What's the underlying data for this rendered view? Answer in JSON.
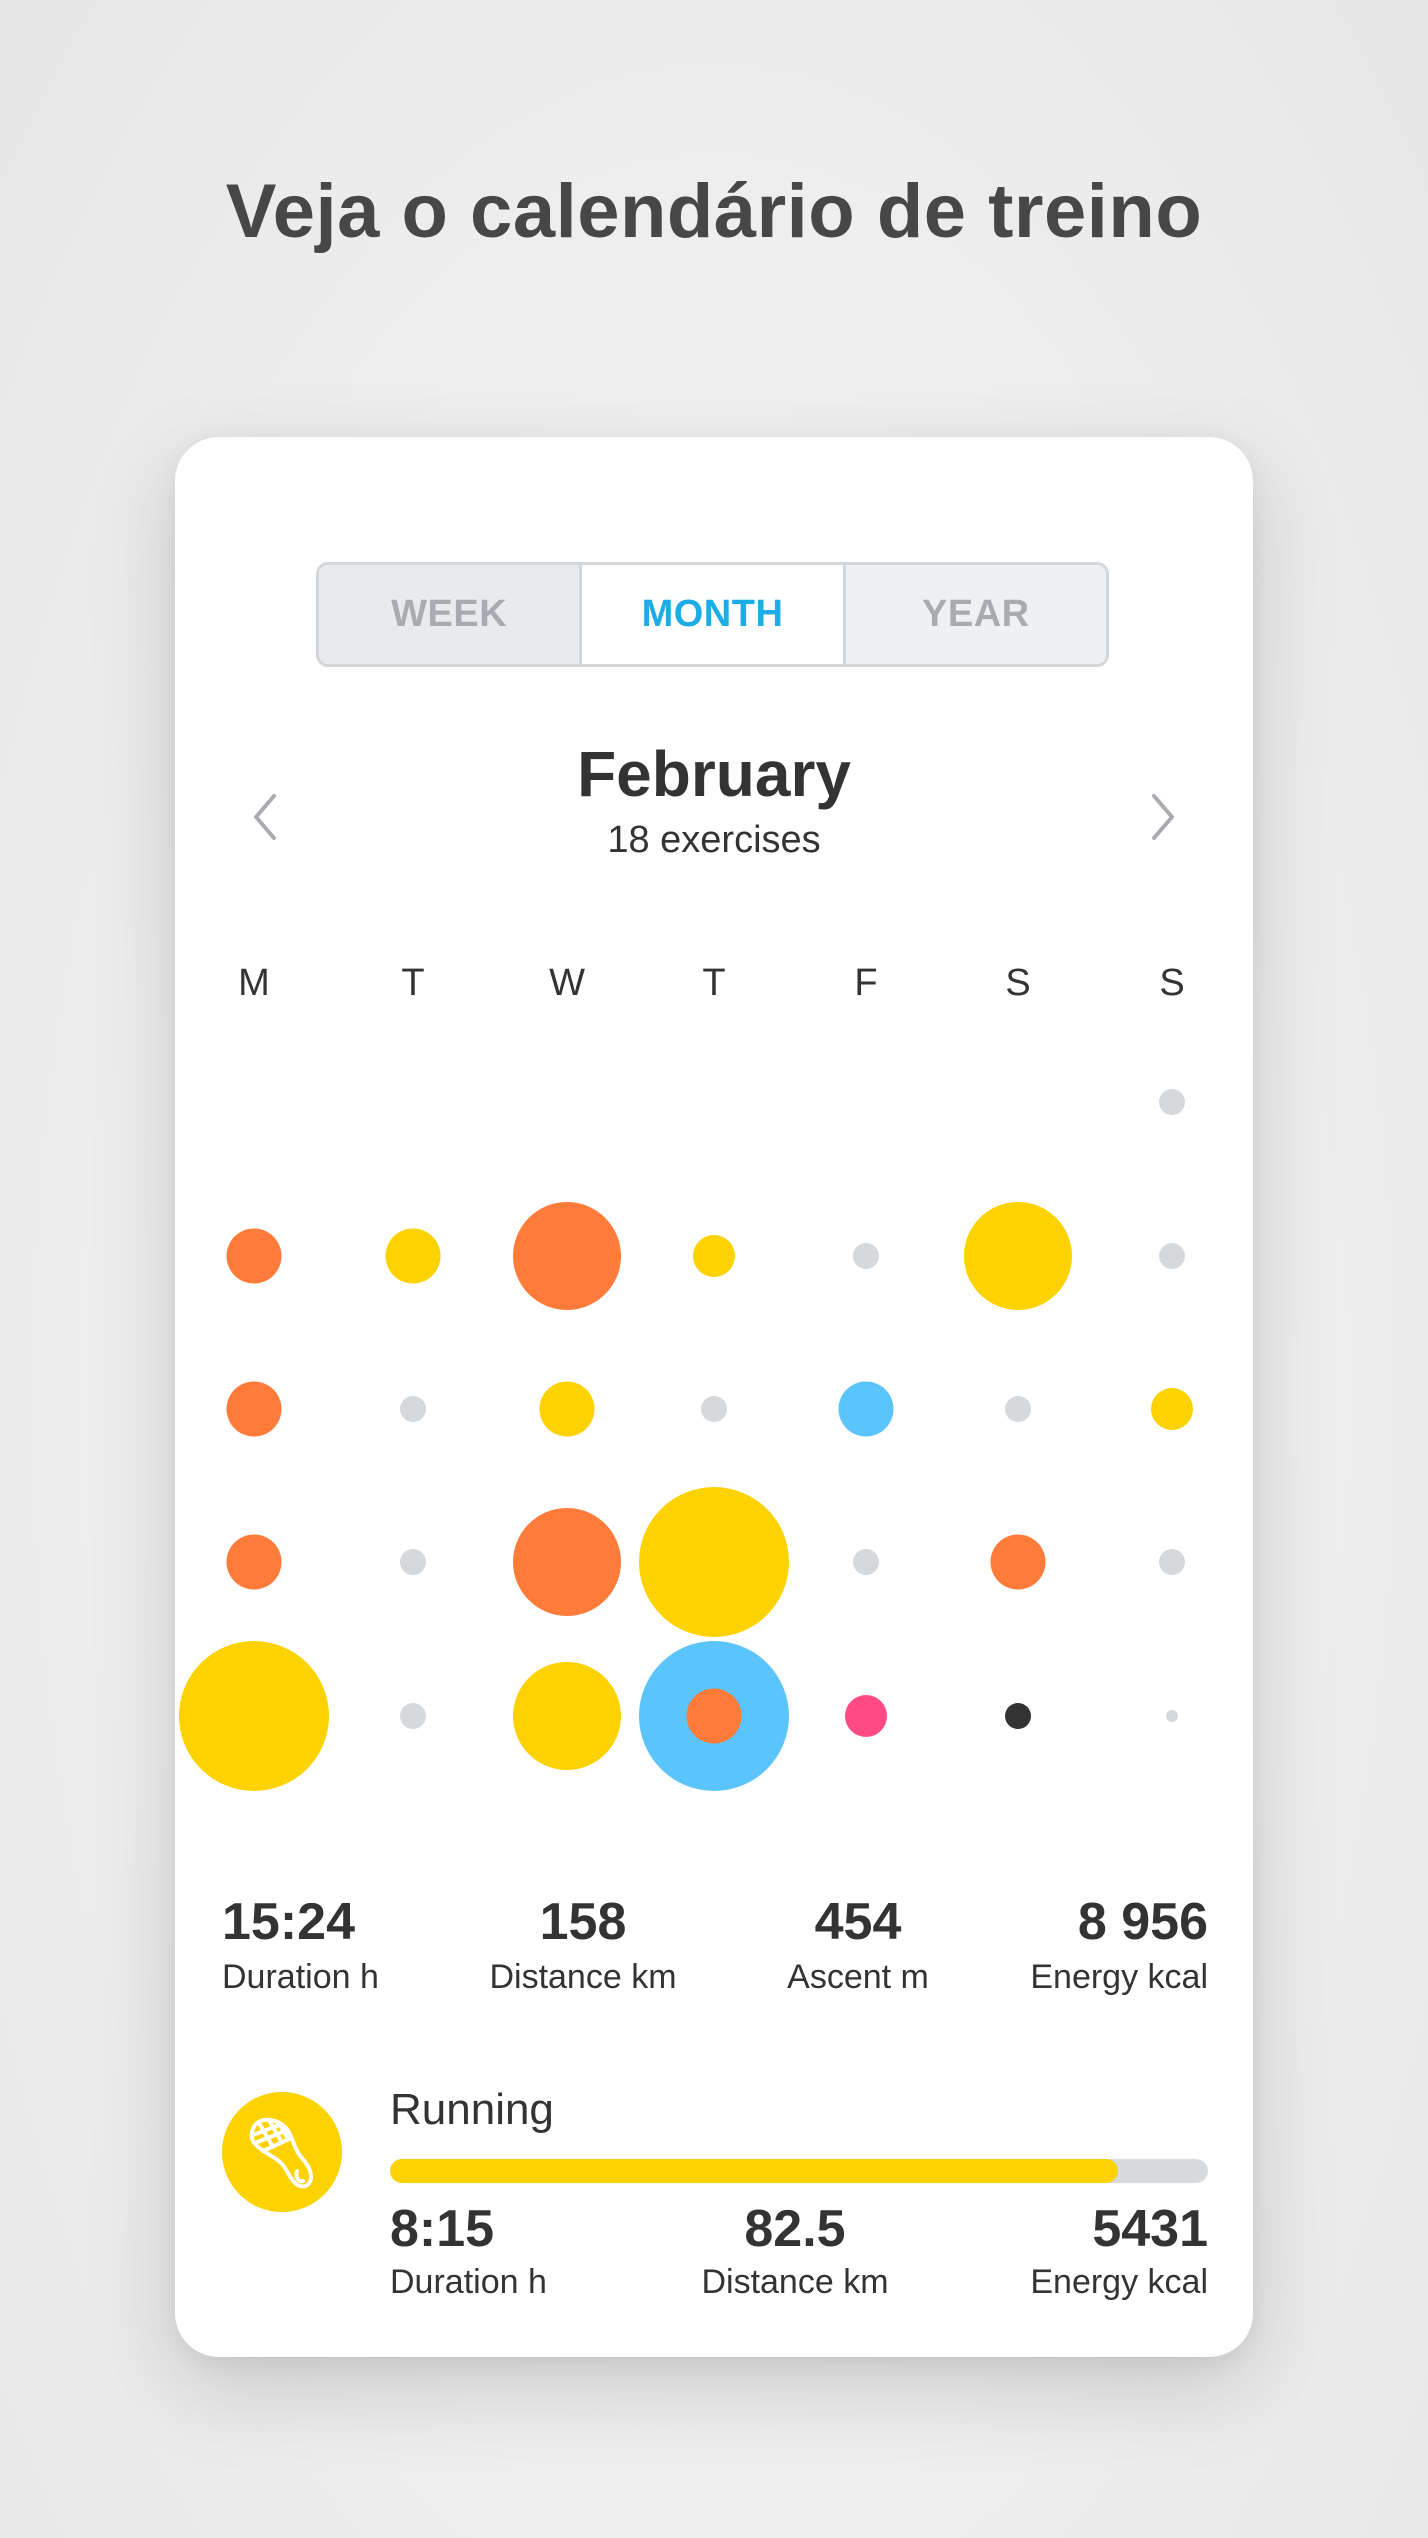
{
  "headline": "Veja o calendário de treino",
  "tabs": [
    {
      "label": "WEEK",
      "active": false
    },
    {
      "label": "MONTH",
      "active": true
    },
    {
      "label": "YEAR",
      "active": false
    }
  ],
  "accent_color": "#1cade6",
  "month": {
    "title": "February",
    "subtitle": "18 exercises",
    "prev_icon": "chevron-left-icon",
    "next_icon": "chevron-right-icon"
  },
  "weekdays": [
    "M",
    "T",
    "W",
    "T",
    "F",
    "S",
    "S"
  ],
  "colors": {
    "running": "#fcd200",
    "cycling": "#ff7b39",
    "swimming": "#5bc5fb",
    "other_pink": "#ff4a83",
    "other_dark": "#333333",
    "rest": "#d6d9dc"
  },
  "calendar": {
    "size_scale": [
      "tiny",
      "small",
      "medium",
      "large",
      "xlarge"
    ],
    "weeks": [
      [
        null,
        null,
        null,
        null,
        null,
        null,
        {
          "type": "rest",
          "size": "small"
        }
      ],
      [
        {
          "type": "cycling",
          "size": "medium"
        },
        {
          "type": "running",
          "size": "medium"
        },
        {
          "type": "cycling",
          "size": "large"
        },
        {
          "type": "running",
          "size": "small_medium"
        },
        {
          "type": "rest",
          "size": "small"
        },
        {
          "type": "running",
          "size": "large"
        },
        {
          "type": "rest",
          "size": "small"
        }
      ],
      [
        {
          "type": "cycling",
          "size": "medium"
        },
        {
          "type": "rest",
          "size": "small"
        },
        {
          "type": "running",
          "size": "medium"
        },
        {
          "type": "rest",
          "size": "small"
        },
        {
          "type": "swimming",
          "size": "medium"
        },
        {
          "type": "rest",
          "size": "small"
        },
        {
          "type": "running",
          "size": "small_medium"
        }
      ],
      [
        {
          "type": "cycling",
          "size": "medium"
        },
        {
          "type": "rest",
          "size": "small"
        },
        {
          "type": "cycling",
          "size": "large"
        },
        {
          "type": "running",
          "size": "xlarge"
        },
        {
          "type": "rest",
          "size": "small"
        },
        {
          "type": "cycling",
          "size": "medium"
        },
        {
          "type": "rest",
          "size": "small"
        }
      ],
      [
        {
          "type": "running",
          "size": "xlarge"
        },
        {
          "type": "rest",
          "size": "small"
        },
        {
          "type": "running",
          "size": "large"
        },
        {
          "type": "swimming",
          "size": "xlarge",
          "inner": {
            "type": "cycling",
            "size": "medium"
          }
        },
        {
          "type": "other_pink",
          "size": "small_medium"
        },
        {
          "type": "other_dark",
          "size": "small"
        },
        {
          "type": "rest",
          "size": "tiny"
        }
      ]
    ]
  },
  "summary": [
    {
      "value": "15:24",
      "label": "Duration h"
    },
    {
      "value": "158",
      "label": "Distance km"
    },
    {
      "value": "454",
      "label": "Ascent m"
    },
    {
      "value": "8 956",
      "label": "Energy kcal"
    }
  ],
  "sport": {
    "name": "Running",
    "icon": "running-shoe-icon",
    "progress_fraction": 0.89,
    "stats": [
      {
        "value": "8:15",
        "label": "Duration h"
      },
      {
        "value": "82.5",
        "label": "Distance km"
      },
      {
        "value": "5431",
        "label": "Energy kcal"
      }
    ]
  }
}
